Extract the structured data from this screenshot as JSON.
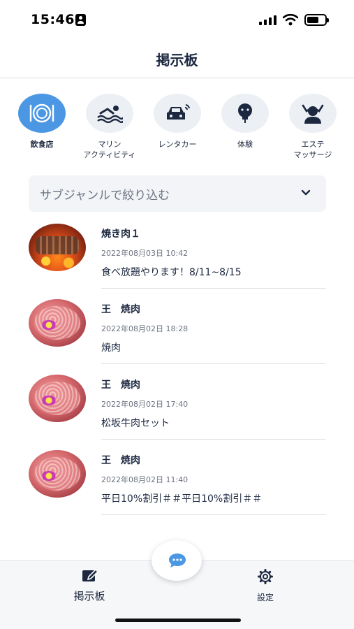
{
  "status_bar": {
    "time": "15:46"
  },
  "header": {
    "title": "掲示板"
  },
  "categories": [
    {
      "label": "飲食店",
      "icon": "dining-icon",
      "active": true
    },
    {
      "label": "マリン\nアクティビティ",
      "icon": "swimming-icon",
      "active": false
    },
    {
      "label": "レンタカー",
      "icon": "car-icon",
      "active": false
    },
    {
      "label": "体験",
      "icon": "lightbulb-icon",
      "active": false
    },
    {
      "label": "エステ\nマッサージ",
      "icon": "massage-icon",
      "active": false
    }
  ],
  "filter": {
    "placeholder": "サブジャンルで絞り込む"
  },
  "posts": [
    {
      "title": "焼き肉１",
      "date": "2022年08月03日 10:42",
      "body": "食べ放題やります！8/11~8/15",
      "thumbnail": "grill-photo"
    },
    {
      "title": "王　焼肉",
      "date": "2022年08月02日 18:28",
      "body": "焼肉",
      "thumbnail": "beef-photo"
    },
    {
      "title": "王　焼肉",
      "date": "2022年08月02日 17:40",
      "body": "松坂牛肉セット",
      "thumbnail": "beef-photo"
    },
    {
      "title": "王　焼肉",
      "date": "2022年08月02日 11:40",
      "body": "平日10%割引＃＃平日10%割引＃＃",
      "thumbnail": "beef-photo"
    }
  ],
  "bottom_nav": {
    "board_label": "掲示板",
    "settings_label": "設定"
  },
  "colors": {
    "accent": "#4b97e4",
    "text": "#1c2840",
    "muted": "#6b7280"
  }
}
